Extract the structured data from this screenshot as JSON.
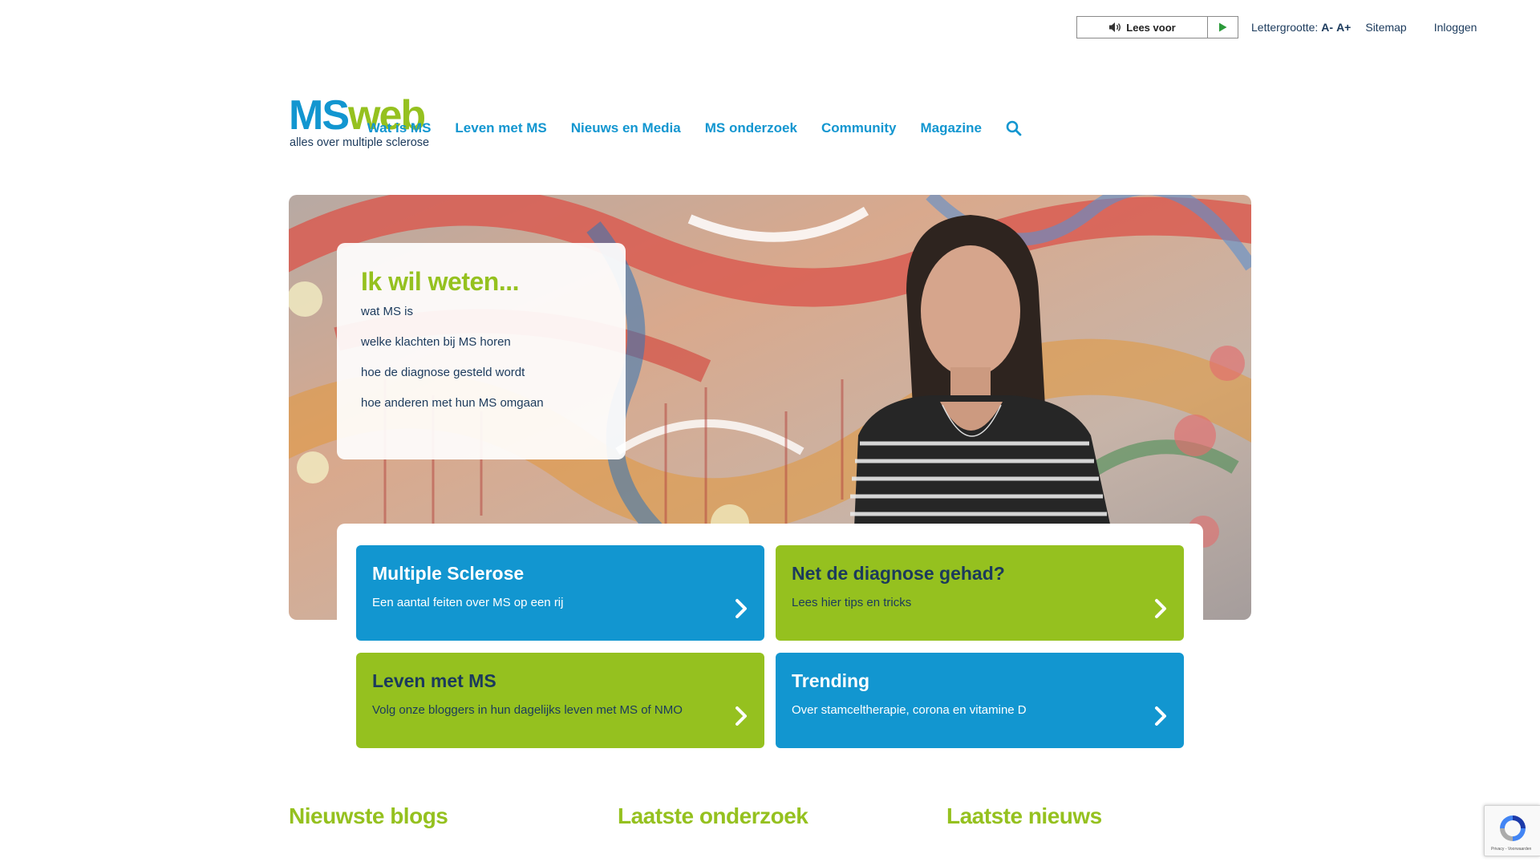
{
  "utility": {
    "read_aloud_label": "Lees voor",
    "font_size_label": "Lettergrootte:",
    "font_decrease": "A-",
    "font_increase": "A+",
    "sitemap": "Sitemap",
    "login": "Inloggen"
  },
  "logo": {
    "ms": "MS",
    "web": "web",
    "tagline": "alles over multiple sclerose"
  },
  "nav": {
    "items": [
      "Wat is MS",
      "Leven met MS",
      "Nieuws en Media",
      "MS onderzoek",
      "Community",
      "Magazine"
    ]
  },
  "hero": {
    "title": "Ik wil weten...",
    "questions": [
      "wat MS is",
      "welke klachten bij MS horen",
      "hoe de diagnose gesteld wordt",
      "hoe anderen met hun MS omgaan"
    ]
  },
  "tiles": [
    {
      "title": "Multiple Sclerose",
      "subtitle": "Een aantal feiten over MS op een rij",
      "color": "#1296d0"
    },
    {
      "title": "Net de diagnose gehad?",
      "subtitle": "Lees hier tips en tricks",
      "color": "#95c11f"
    },
    {
      "title": "Leven met MS",
      "subtitle": "Volg onze bloggers in hun dagelijks leven met MS of NMO",
      "color": "#95c11f"
    },
    {
      "title": "Trending",
      "subtitle": "Over stamceltherapie, corona en vitamine D",
      "color": "#1296d0"
    }
  ],
  "sections": [
    "Nieuwste blogs",
    "Laatste onderzoek",
    "Laatste nieuws"
  ],
  "recaptcha": {
    "text": "Privacy - Voorwaarden"
  },
  "colors": {
    "brand_blue": "#1296d0",
    "brand_green": "#95c11f",
    "text_dark": "#1b3a5c"
  }
}
